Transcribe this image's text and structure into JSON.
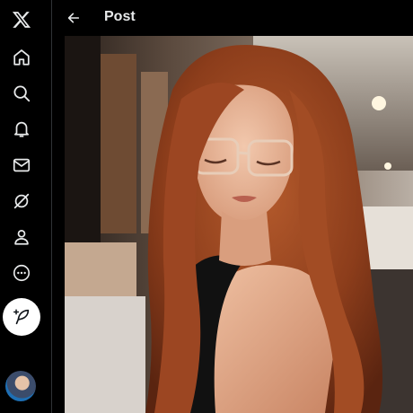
{
  "header": {
    "title": "Post"
  },
  "sidebar": {
    "items": [
      {
        "name": "logo",
        "icon": "x-logo-icon"
      },
      {
        "name": "home",
        "icon": "home-icon"
      },
      {
        "name": "explore",
        "icon": "search-icon"
      },
      {
        "name": "notifications",
        "icon": "bell-icon"
      },
      {
        "name": "messages",
        "icon": "envelope-icon"
      },
      {
        "name": "grok",
        "icon": "grok-icon"
      },
      {
        "name": "profile",
        "icon": "person-icon"
      },
      {
        "name": "more",
        "icon": "more-circle-icon"
      }
    ],
    "compose_icon": "feather-plus-icon",
    "avatar": "user-avatar"
  },
  "media": {
    "kind": "photo",
    "subject": "woman-with-red-hair-glasses"
  },
  "colors": {
    "background": "#000000",
    "text": "#e7e9ea",
    "compose_bg": "#ffffff",
    "border": "#2f3336"
  }
}
